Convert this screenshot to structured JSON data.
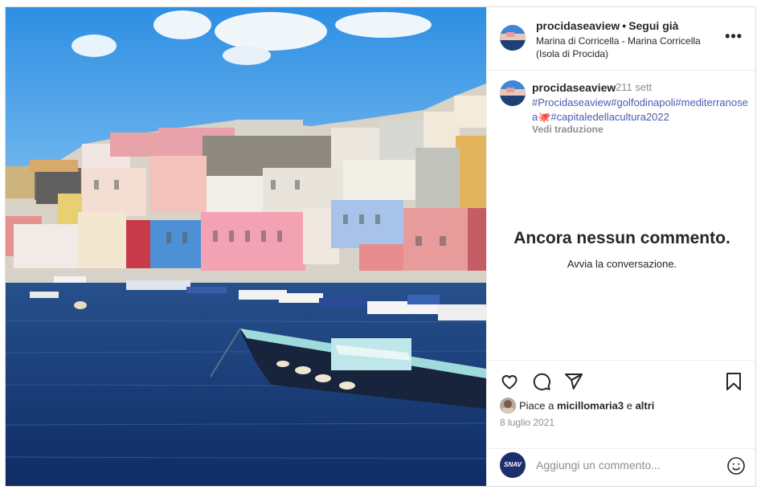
{
  "header": {
    "username": "procidaseaview",
    "separator": "•",
    "follow_label": "Segui già",
    "location": "Marina di Corricella - Marina Corricella (Isola di Procida)",
    "more_label": "•••"
  },
  "caption": {
    "username": "procidaseaview",
    "time": "211 sett",
    "hashtags": "#Procidaseaview#golfodinapoli#mediterranosea🐙#capitaledellacultura2022",
    "translate_label": "Vedi traduzione"
  },
  "comments": {
    "empty_title": "Ancora nessun commento.",
    "empty_subtitle": "Avvia la conversazione."
  },
  "actions": {
    "like_icon": "heart-icon",
    "comment_icon": "comment-icon",
    "share_icon": "send-icon",
    "save_icon": "bookmark-icon"
  },
  "likes": {
    "prefix": "Piace a ",
    "user": "micillomaria3",
    "middle": " e ",
    "others": "altri"
  },
  "date": "8 luglio 2021",
  "comment_box": {
    "avatar_text": "SNAV",
    "placeholder": "Aggiungi un commento...",
    "emoji_icon": "smiley-icon"
  },
  "colors": {
    "hashtag": "#4a5bb4",
    "muted": "#8e8e8e",
    "text": "#262626"
  }
}
